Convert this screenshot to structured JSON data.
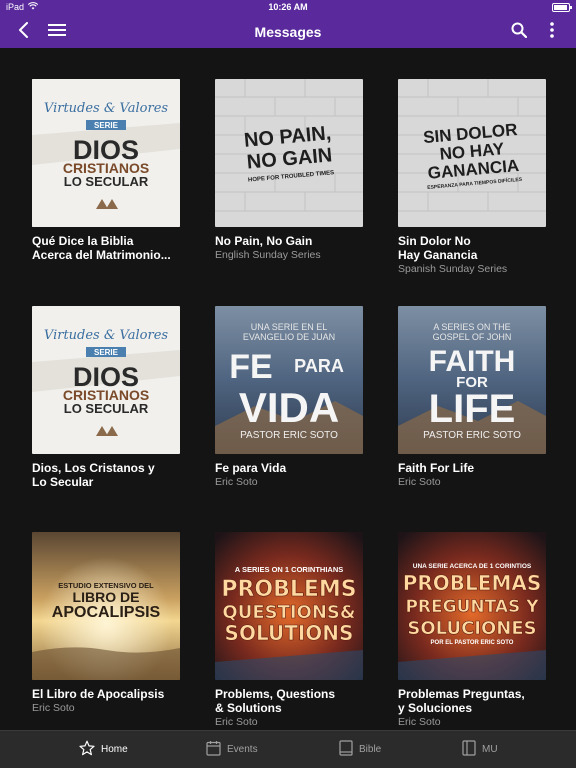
{
  "status": {
    "device": "iPad",
    "time": "10:26 AM"
  },
  "header": {
    "title": "Messages"
  },
  "cards": [
    {
      "title": "Qué Dice la Biblia\nAcerca del Matrimonio...",
      "subtitle": "",
      "art": {
        "l1": "Virtudes & Valores",
        "l2": "SERIE",
        "l3": "DIOS",
        "l4": "CRISTIANOS",
        "l5": "LO SECULAR"
      }
    },
    {
      "title": "No Pain, No Gain",
      "subtitle": "English Sunday Series",
      "art": {
        "l1": "NO PAIN,",
        "l2": "NO GAIN",
        "l3": "HOPE FOR TROUBLED TIMES"
      }
    },
    {
      "title": "Sin Dolor No\nHay Ganancia",
      "subtitle": "Spanish Sunday Series",
      "art": {
        "l1": "SIN DOLOR",
        "l2": "NO HAY",
        "l3": "GANANCIA",
        "l4": "ESPERANZA PARA TIEMPOS DIFÍCILES"
      }
    },
    {
      "title": "Dios, Los Cristanos y\nLo Secular",
      "subtitle": "",
      "art": {
        "l1": "Virtudes & Valores",
        "l2": "SERIE",
        "l3": "DIOS",
        "l4": "CRISTIANOS",
        "l5": "LO SECULAR"
      }
    },
    {
      "title": "Fe para Vida",
      "subtitle": "Eric Soto",
      "art": {
        "l1": "UNA SERIE EN EL",
        "l2": "EVANGELIO DE JUAN",
        "l3": "FE",
        "l4": "PARA",
        "l5": "VIDA",
        "l6": "PASTOR ERIC SOTO"
      }
    },
    {
      "title": "Faith For Life",
      "subtitle": "Eric Soto",
      "art": {
        "l1": "A SERIES ON THE",
        "l2": "GOSPEL OF JOHN",
        "l3": "FAITH",
        "l4": "FOR",
        "l5": "LIFE",
        "l6": "PASTOR ERIC SOTO"
      }
    },
    {
      "title": "El Libro de Apocalipsis",
      "subtitle": "Eric Soto",
      "art": {
        "l1": "ESTUDIO EXTENSIVO DEL",
        "l2": "LIBRO DE",
        "l3": "APOCALIPSIS"
      }
    },
    {
      "title": "Problems, Questions\n& Solutions",
      "subtitle": "Eric Soto",
      "art": {
        "l1": "A SERIES ON 1 CORINTHIANS",
        "l2": "PROBLEMS",
        "l3": "QUESTIONS&",
        "l4": "SOLUTIONS"
      }
    },
    {
      "title": "Problemas Preguntas,\ny Soluciones",
      "subtitle": "Eric Soto",
      "art": {
        "l1": "UNA SERIE ACERCA DE 1 CORINTIOS",
        "l2": "PROBLEMAS",
        "l3": "PREGUNTAS Y",
        "l4": "SOLUCIONES",
        "l5": "POR EL PASTOR ERIC SOTO"
      }
    }
  ],
  "tabs": [
    {
      "label": "Home",
      "icon": "star-icon",
      "active": true
    },
    {
      "label": "Events",
      "icon": "calendar-icon",
      "active": false
    },
    {
      "label": "Bible",
      "icon": "book-icon",
      "active": false
    },
    {
      "label": "MU",
      "icon": "columns-icon",
      "active": false
    }
  ],
  "colors": {
    "header": "#5a2a9c",
    "background": "#141414",
    "tabbar": "#2b2b2b"
  }
}
